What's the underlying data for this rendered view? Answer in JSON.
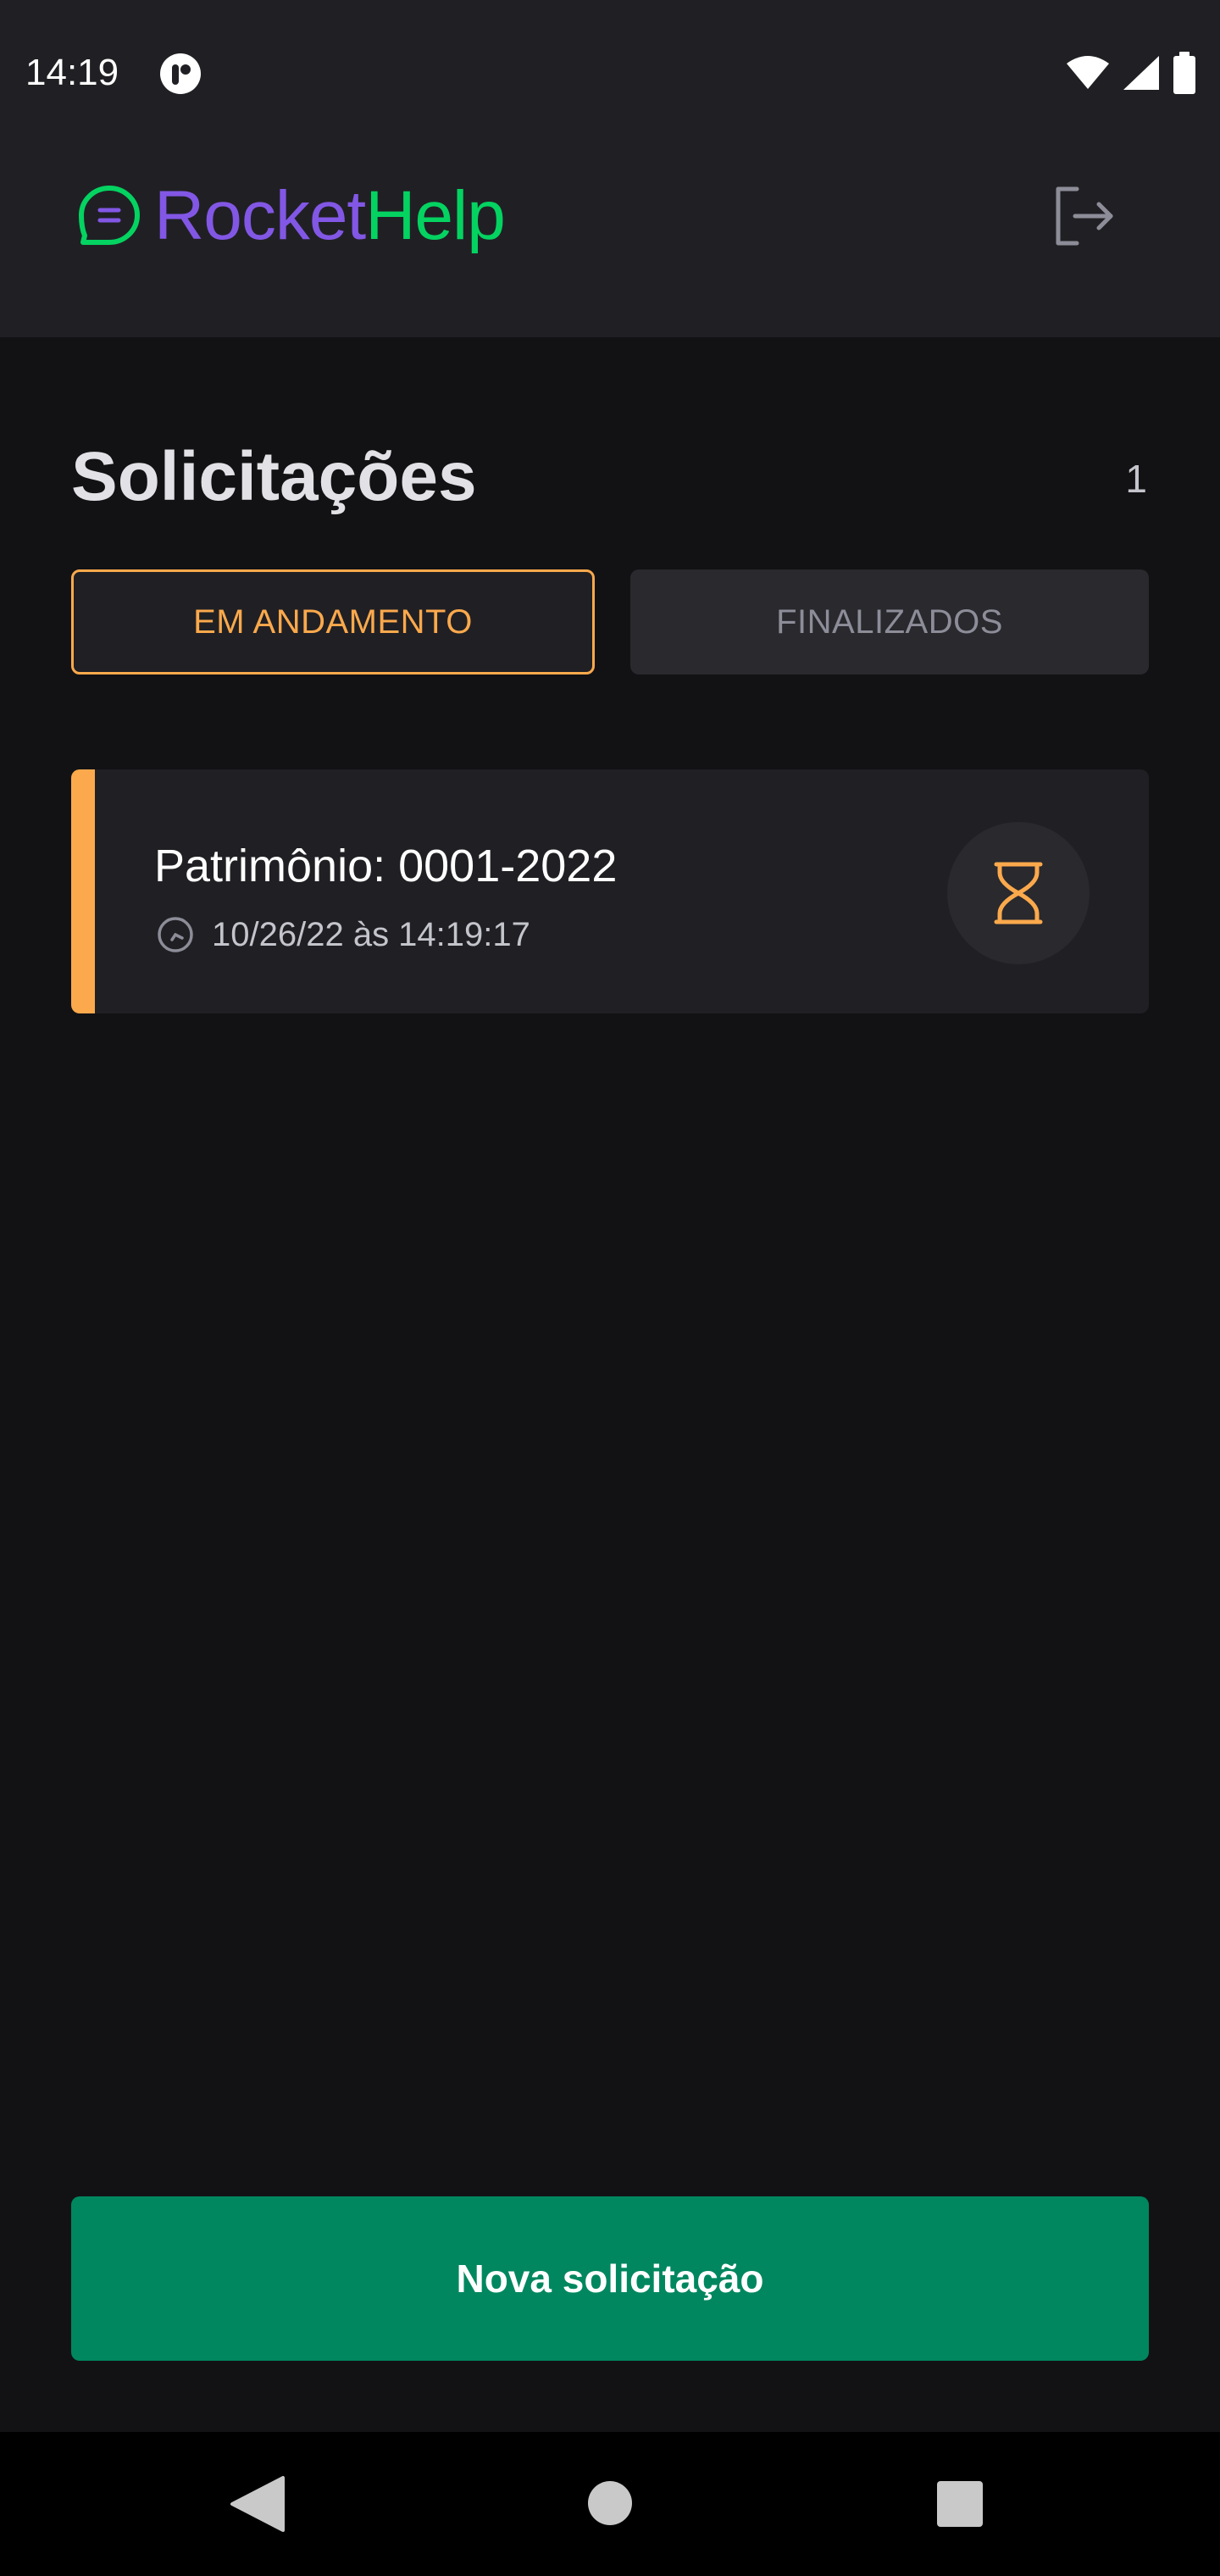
{
  "status_bar": {
    "time": "14:19",
    "icons": [
      "app-notification-icon",
      "wifi-icon",
      "cell-signal-icon",
      "battery-icon"
    ]
  },
  "header": {
    "logo": {
      "part1": "Rocket",
      "part2": "Help",
      "icon": "chat-bubble-icon"
    },
    "logout_icon": "sign-out-icon"
  },
  "main": {
    "title": "Solicitações",
    "count": "1",
    "filters": [
      {
        "label": "EM ANDAMENTO",
        "selected": true
      },
      {
        "label": "FINALIZADOS",
        "selected": false
      }
    ],
    "requests": [
      {
        "title": "Patrimônio: 0001-2022",
        "date": "10/26/22 às 14:19:17",
        "status": "open",
        "status_icon": "hourglass-icon",
        "time_icon": "clock-icon"
      }
    ],
    "new_request_label": "Nova solicitação"
  },
  "colors": {
    "background": "#121214",
    "surface": "#202024",
    "surface_alt": "#29292e",
    "primary": "#00875f",
    "accent_open": "#fba94c",
    "brand_purple": "#8257e5",
    "brand_green": "#04d361",
    "text_muted": "#8d8d99"
  },
  "nav_bar": {
    "icons": [
      "back-icon",
      "home-icon",
      "recents-icon"
    ]
  }
}
